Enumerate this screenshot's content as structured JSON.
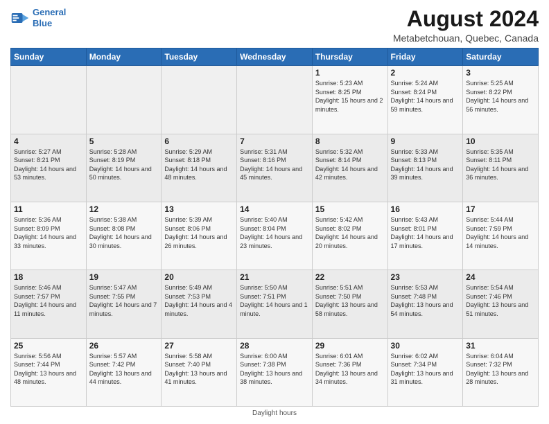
{
  "header": {
    "logo_line1": "General",
    "logo_line2": "Blue",
    "main_title": "August 2024",
    "subtitle": "Metabetchouan, Quebec, Canada"
  },
  "days_of_week": [
    "Sunday",
    "Monday",
    "Tuesday",
    "Wednesday",
    "Thursday",
    "Friday",
    "Saturday"
  ],
  "weeks": [
    [
      {
        "day": "",
        "info": ""
      },
      {
        "day": "",
        "info": ""
      },
      {
        "day": "",
        "info": ""
      },
      {
        "day": "",
        "info": ""
      },
      {
        "day": "1",
        "info": "Sunrise: 5:23 AM\nSunset: 8:25 PM\nDaylight: 15 hours and 2 minutes."
      },
      {
        "day": "2",
        "info": "Sunrise: 5:24 AM\nSunset: 8:24 PM\nDaylight: 14 hours and 59 minutes."
      },
      {
        "day": "3",
        "info": "Sunrise: 5:25 AM\nSunset: 8:22 PM\nDaylight: 14 hours and 56 minutes."
      }
    ],
    [
      {
        "day": "4",
        "info": "Sunrise: 5:27 AM\nSunset: 8:21 PM\nDaylight: 14 hours and 53 minutes."
      },
      {
        "day": "5",
        "info": "Sunrise: 5:28 AM\nSunset: 8:19 PM\nDaylight: 14 hours and 50 minutes."
      },
      {
        "day": "6",
        "info": "Sunrise: 5:29 AM\nSunset: 8:18 PM\nDaylight: 14 hours and 48 minutes."
      },
      {
        "day": "7",
        "info": "Sunrise: 5:31 AM\nSunset: 8:16 PM\nDaylight: 14 hours and 45 minutes."
      },
      {
        "day": "8",
        "info": "Sunrise: 5:32 AM\nSunset: 8:14 PM\nDaylight: 14 hours and 42 minutes."
      },
      {
        "day": "9",
        "info": "Sunrise: 5:33 AM\nSunset: 8:13 PM\nDaylight: 14 hours and 39 minutes."
      },
      {
        "day": "10",
        "info": "Sunrise: 5:35 AM\nSunset: 8:11 PM\nDaylight: 14 hours and 36 minutes."
      }
    ],
    [
      {
        "day": "11",
        "info": "Sunrise: 5:36 AM\nSunset: 8:09 PM\nDaylight: 14 hours and 33 minutes."
      },
      {
        "day": "12",
        "info": "Sunrise: 5:38 AM\nSunset: 8:08 PM\nDaylight: 14 hours and 30 minutes."
      },
      {
        "day": "13",
        "info": "Sunrise: 5:39 AM\nSunset: 8:06 PM\nDaylight: 14 hours and 26 minutes."
      },
      {
        "day": "14",
        "info": "Sunrise: 5:40 AM\nSunset: 8:04 PM\nDaylight: 14 hours and 23 minutes."
      },
      {
        "day": "15",
        "info": "Sunrise: 5:42 AM\nSunset: 8:02 PM\nDaylight: 14 hours and 20 minutes."
      },
      {
        "day": "16",
        "info": "Sunrise: 5:43 AM\nSunset: 8:01 PM\nDaylight: 14 hours and 17 minutes."
      },
      {
        "day": "17",
        "info": "Sunrise: 5:44 AM\nSunset: 7:59 PM\nDaylight: 14 hours and 14 minutes."
      }
    ],
    [
      {
        "day": "18",
        "info": "Sunrise: 5:46 AM\nSunset: 7:57 PM\nDaylight: 14 hours and 11 minutes."
      },
      {
        "day": "19",
        "info": "Sunrise: 5:47 AM\nSunset: 7:55 PM\nDaylight: 14 hours and 7 minutes."
      },
      {
        "day": "20",
        "info": "Sunrise: 5:49 AM\nSunset: 7:53 PM\nDaylight: 14 hours and 4 minutes."
      },
      {
        "day": "21",
        "info": "Sunrise: 5:50 AM\nSunset: 7:51 PM\nDaylight: 14 hours and 1 minute."
      },
      {
        "day": "22",
        "info": "Sunrise: 5:51 AM\nSunset: 7:50 PM\nDaylight: 13 hours and 58 minutes."
      },
      {
        "day": "23",
        "info": "Sunrise: 5:53 AM\nSunset: 7:48 PM\nDaylight: 13 hours and 54 minutes."
      },
      {
        "day": "24",
        "info": "Sunrise: 5:54 AM\nSunset: 7:46 PM\nDaylight: 13 hours and 51 minutes."
      }
    ],
    [
      {
        "day": "25",
        "info": "Sunrise: 5:56 AM\nSunset: 7:44 PM\nDaylight: 13 hours and 48 minutes."
      },
      {
        "day": "26",
        "info": "Sunrise: 5:57 AM\nSunset: 7:42 PM\nDaylight: 13 hours and 44 minutes."
      },
      {
        "day": "27",
        "info": "Sunrise: 5:58 AM\nSunset: 7:40 PM\nDaylight: 13 hours and 41 minutes."
      },
      {
        "day": "28",
        "info": "Sunrise: 6:00 AM\nSunset: 7:38 PM\nDaylight: 13 hours and 38 minutes."
      },
      {
        "day": "29",
        "info": "Sunrise: 6:01 AM\nSunset: 7:36 PM\nDaylight: 13 hours and 34 minutes."
      },
      {
        "day": "30",
        "info": "Sunrise: 6:02 AM\nSunset: 7:34 PM\nDaylight: 13 hours and 31 minutes."
      },
      {
        "day": "31",
        "info": "Sunrise: 6:04 AM\nSunset: 7:32 PM\nDaylight: 13 hours and 28 minutes."
      }
    ]
  ],
  "footer": "Daylight hours"
}
